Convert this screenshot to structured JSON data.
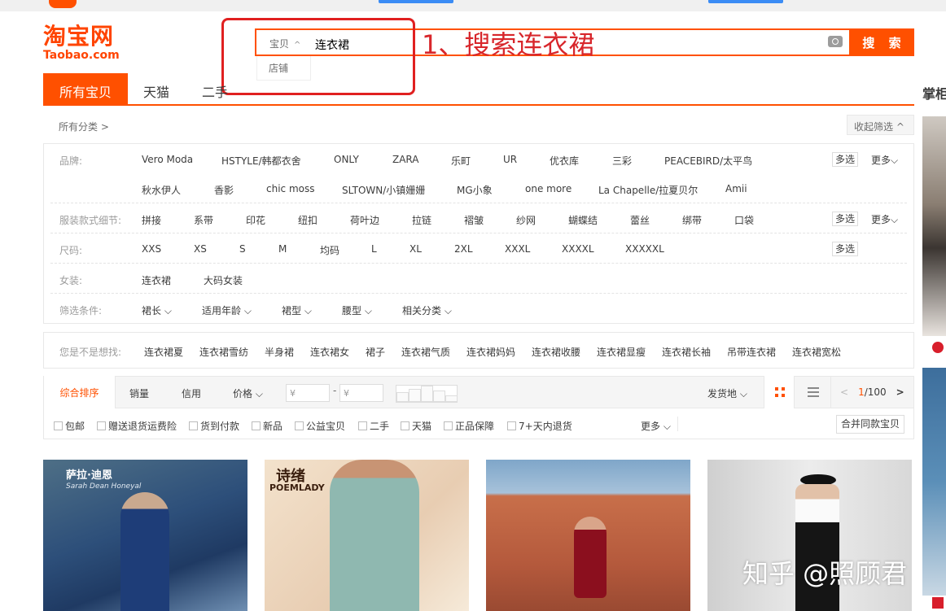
{
  "logo": {
    "cn": "淘宝网",
    "en": "Taobao.com"
  },
  "search": {
    "type_label": "宝贝",
    "type_caret": "^",
    "query": "连衣裙",
    "button": "搜 索",
    "dropdown_option": "店铺"
  },
  "annotation": "1、搜索连衣裙",
  "tabs": [
    "所有宝贝",
    "天猫",
    "二手"
  ],
  "side_label": "掌柜",
  "crumb": "所有分类 >",
  "collapse": "收起筛选 ^",
  "filters": {
    "brand": {
      "label": "品牌:",
      "row1": [
        "Vero Moda",
        "HSTYLE/韩都衣舍",
        "ONLY",
        "ZARA",
        "乐町",
        "UR",
        "优衣库",
        "三彩",
        "PEACEBIRD/太平鸟"
      ],
      "row2": [
        "秋水伊人",
        "香影",
        "chic moss",
        "SLTOWN/小镇姗姗",
        "MG小象",
        "one more",
        "La Chapelle/拉夏贝尔",
        "Amii"
      ]
    },
    "detail": {
      "label": "服装款式细节:",
      "items": [
        "拼接",
        "系带",
        "印花",
        "纽扣",
        "荷叶边",
        "拉链",
        "褶皱",
        "纱网",
        "蝴蝶结",
        "蕾丝",
        "绑带",
        "口袋"
      ]
    },
    "size": {
      "label": "尺码:",
      "items": [
        "XXS",
        "XS",
        "S",
        "M",
        "均码",
        "L",
        "XL",
        "2XL",
        "XXXL",
        "XXXXL",
        "XXXXXL"
      ]
    },
    "women": {
      "label": "女装:",
      "items": [
        "连衣裙",
        "大码女装"
      ]
    },
    "conditions": {
      "label": "筛选条件:",
      "items": [
        "裙长 ⌵",
        "适用年龄 ⌵",
        "裙型 ⌵",
        "腰型 ⌵",
        "相关分类 ⌵"
      ]
    },
    "multi": "多选",
    "more": "更多⌵"
  },
  "suggest": {
    "label": "您是不是想找:",
    "items": [
      "连衣裙夏",
      "连衣裙雪纺",
      "半身裙",
      "连衣裙女",
      "裙子",
      "连衣裙气质",
      "连衣裙妈妈",
      "连衣裙收腰",
      "连衣裙显瘦",
      "连衣裙长袖",
      "吊带连衣裙",
      "连衣裙宽松"
    ]
  },
  "sort": {
    "active": "综合排序",
    "items": [
      "销量",
      "信用",
      "价格 ⌵"
    ],
    "price_placeholder": "¥",
    "dash": "-",
    "ship_from": "发货地 ⌵",
    "page_current": "1",
    "page_total": "/100",
    "prev": "<",
    "next": ">"
  },
  "checks": {
    "items": [
      "包邮",
      "赠送退货运费险",
      "货到付款",
      "新品",
      "公益宝贝",
      "二手",
      "天猫",
      "正品保障",
      "7+天内退货"
    ],
    "more": "更多 ⌵",
    "merge": "合并同款宝贝"
  },
  "products": [
    {
      "brand": "萨拉·迪恩",
      "sub": "Sarah Dean Honeyal",
      "colors": [
        "#2d4f7a",
        "#1f3a63",
        "#6f8fb2"
      ]
    },
    {
      "brand": "诗绪",
      "sub": "POEMLADY",
      "colors": [
        "#e8cdb2",
        "#8fb8b0",
        "#f3e2cc"
      ]
    },
    {
      "brand": "",
      "sub": "",
      "colors": [
        "#b4593c",
        "#c86f4a",
        "#7fa6c9"
      ]
    },
    {
      "brand": "",
      "sub": "",
      "colors": [
        "#dcdcdc",
        "#f0f0f0",
        "#1a1a1a"
      ]
    }
  ],
  "watermark": "知乎 @照顾君",
  "colors": {
    "accent": "#ff5000",
    "annotation": "#d8262b"
  }
}
